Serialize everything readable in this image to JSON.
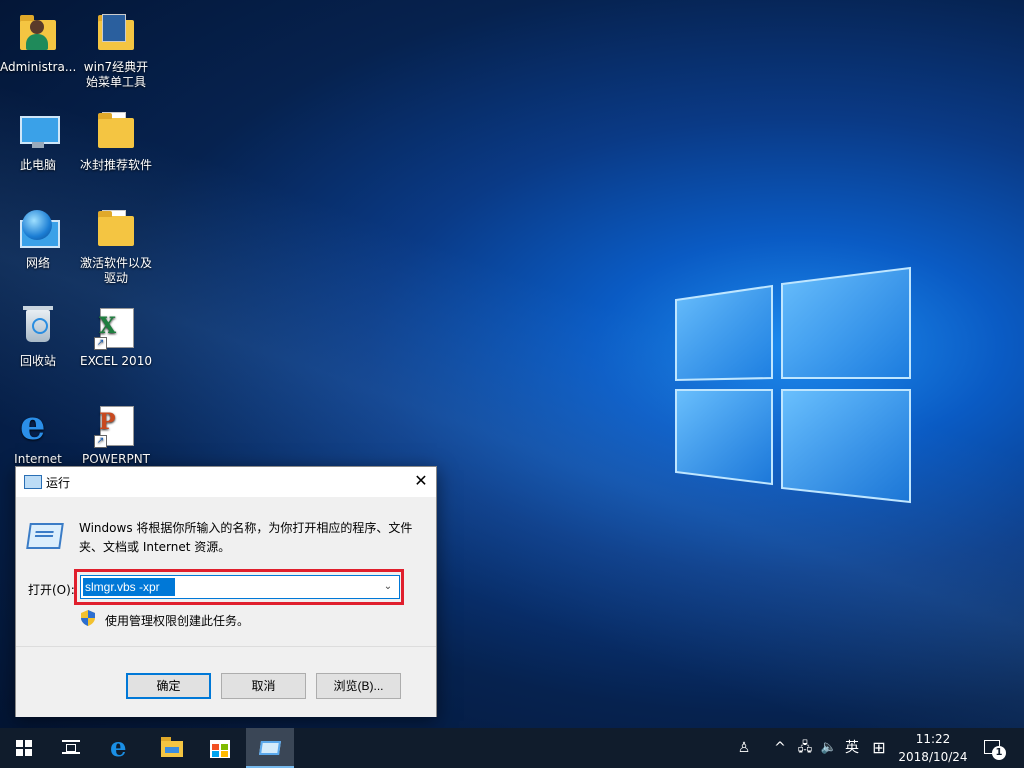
{
  "desktop": {
    "icons": [
      {
        "label": "Administra...",
        "icon": "user-folder-icon"
      },
      {
        "label": "win7经典开始菜单工具",
        "icon": "folder-icon"
      },
      {
        "label": "此电脑",
        "icon": "this-pc-icon"
      },
      {
        "label": "冰封推荐软件",
        "icon": "folder-icon"
      },
      {
        "label": "网络",
        "icon": "network-icon"
      },
      {
        "label": "激活软件以及驱动",
        "icon": "folder-icon"
      },
      {
        "label": "回收站",
        "icon": "recycle-bin-icon"
      },
      {
        "label": "EXCEL 2010",
        "icon": "excel-icon"
      },
      {
        "label": "Internet",
        "icon": "internet-explorer-icon"
      },
      {
        "label": "POWERPNT",
        "icon": "powerpoint-icon"
      }
    ]
  },
  "run_dialog": {
    "title": "运行",
    "close_glyph": "✕",
    "description": "Windows 将根据你所输入的名称，为你打开相应的程序、文件夹、文档或 Internet 资源。",
    "open_label": "打开(O):",
    "open_value": "slmgr.vbs -xpr",
    "dropdown_glyph": "⌄",
    "admin_note": "使用管理权限创建此任务。",
    "buttons": {
      "ok": "确定",
      "cancel": "取消",
      "browse": "浏览(B)..."
    },
    "highlight_color": "#e01f2d",
    "selection_color": "#0078d7"
  },
  "taskbar": {
    "tray": {
      "people_glyph": "♙",
      "chevron_glyph": "^",
      "network_glyph": "🖧",
      "volume_glyph": "🔈",
      "ime_label": "英",
      "keyboard_glyph": "⊞"
    },
    "clock": {
      "time": "11:22",
      "date": "2018/10/24"
    },
    "notification_count": "1"
  }
}
